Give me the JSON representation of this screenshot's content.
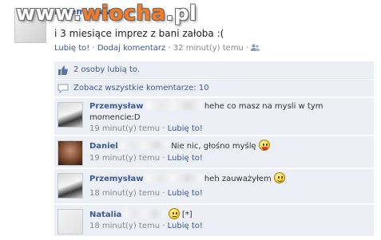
{
  "watermark": {
    "part1": "www.",
    "part2": "wiocha",
    "part3": ".pl"
  },
  "post": {
    "author": "Przemysław",
    "text": "i 3 miesiące imprez z bani załoba :(",
    "actions": {
      "like": "Lubię to!",
      "comment": "Dodaj komentarz",
      "time": "32 minut(y) temu"
    }
  },
  "likes": {
    "text": "2 osoby lubią to."
  },
  "view_all": {
    "text": "Zobacz wszystkie komentarze: 10"
  },
  "comments": [
    {
      "author": "Przemysław",
      "text": "hehe co masz na mysli w tym momencie:D",
      "time": "19 minut(y) temu",
      "like": "Lubię to!"
    },
    {
      "author": "Daniel",
      "text": "Nie nic, głośno myślę",
      "time": "19 minut(y) temu",
      "like": "Lubię to!"
    },
    {
      "author": "Przemysław",
      "text": "heh zauważyłem",
      "time": "18 minut(y) temu",
      "like": "Lubię to!"
    },
    {
      "author": "Natalia",
      "text": "[*]",
      "time": "18 minut(y) temu",
      "like": "Lubię to!"
    }
  ],
  "separator": "·",
  "colors": {
    "link": "#3b5998",
    "comment_bg": "#eceff5",
    "watermark_accent": "#f47c26"
  }
}
